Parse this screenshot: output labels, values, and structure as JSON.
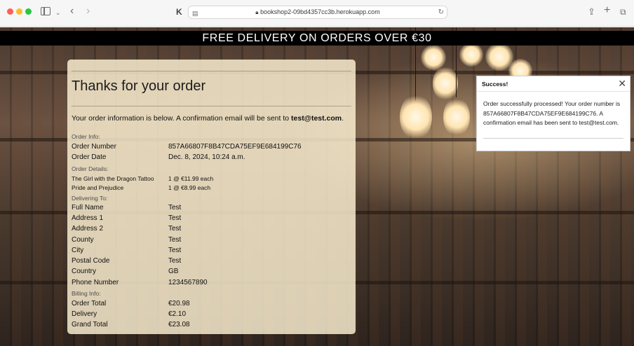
{
  "browser": {
    "url": "bookshop2-09bd4357cc3b.herokuapp.com",
    "icons": [
      "sidebar-icon",
      "chevron-down-icon",
      "back-icon",
      "forward-icon",
      "extension-icon",
      "page-icon",
      "lock-icon",
      "reload-icon",
      "share-icon",
      "new-tab-icon",
      "tabs-icon"
    ]
  },
  "banner": {
    "text": "FREE DELIVERY ON ORDERS OVER €30"
  },
  "order": {
    "title": "Thanks for your order",
    "intro_text": "Your order information is below. A confirmation email will be sent to ",
    "email": "test@test.com",
    "intro_end": ".",
    "sections": {
      "order_info": "Order Info:",
      "order_details": "Order Details:",
      "delivering_to": "Delivering To:",
      "billing_info": "Billing Info:"
    },
    "order_info": [
      {
        "label": "Order Number",
        "value": "857A66807F8B47CDA75EF9E684199C76"
      },
      {
        "label": "Order Date",
        "value": "Dec. 8, 2024, 10:24 a.m."
      }
    ],
    "items": [
      {
        "title": "The Girl with the Dragon Tattoo",
        "qty": "1 @ €11.99 each"
      },
      {
        "title": "Pride and Prejudice",
        "qty": "1 @ €8.99 each"
      }
    ],
    "delivery": [
      {
        "label": "Full Name",
        "value": "Test"
      },
      {
        "label": "Address 1",
        "value": "Test"
      },
      {
        "label": "Address 2",
        "value": "Test"
      },
      {
        "label": "County",
        "value": "Test"
      },
      {
        "label": "City",
        "value": "Test"
      },
      {
        "label": "Postal Code",
        "value": "Test"
      },
      {
        "label": "Country",
        "value": "GB"
      },
      {
        "label": "Phone Number",
        "value": "1234567890"
      }
    ],
    "billing": [
      {
        "label": "Order Total",
        "value": "€20.98"
      },
      {
        "label": "Delivery",
        "value": "€2.10"
      },
      {
        "label": "Grand Total",
        "value": "€23.08"
      }
    ]
  },
  "toast": {
    "title": "Success!",
    "message": "Order successfully processed! Your order number is 857A66807F8B47CDA75EF9E684199C76. A confirmation email has been sent to test@test.com.",
    "close_icon": "close-icon"
  },
  "colors": {
    "banner_bg": "#000000",
    "card_bg": "#fcf0d2",
    "toast_bg": "#ffffff"
  }
}
